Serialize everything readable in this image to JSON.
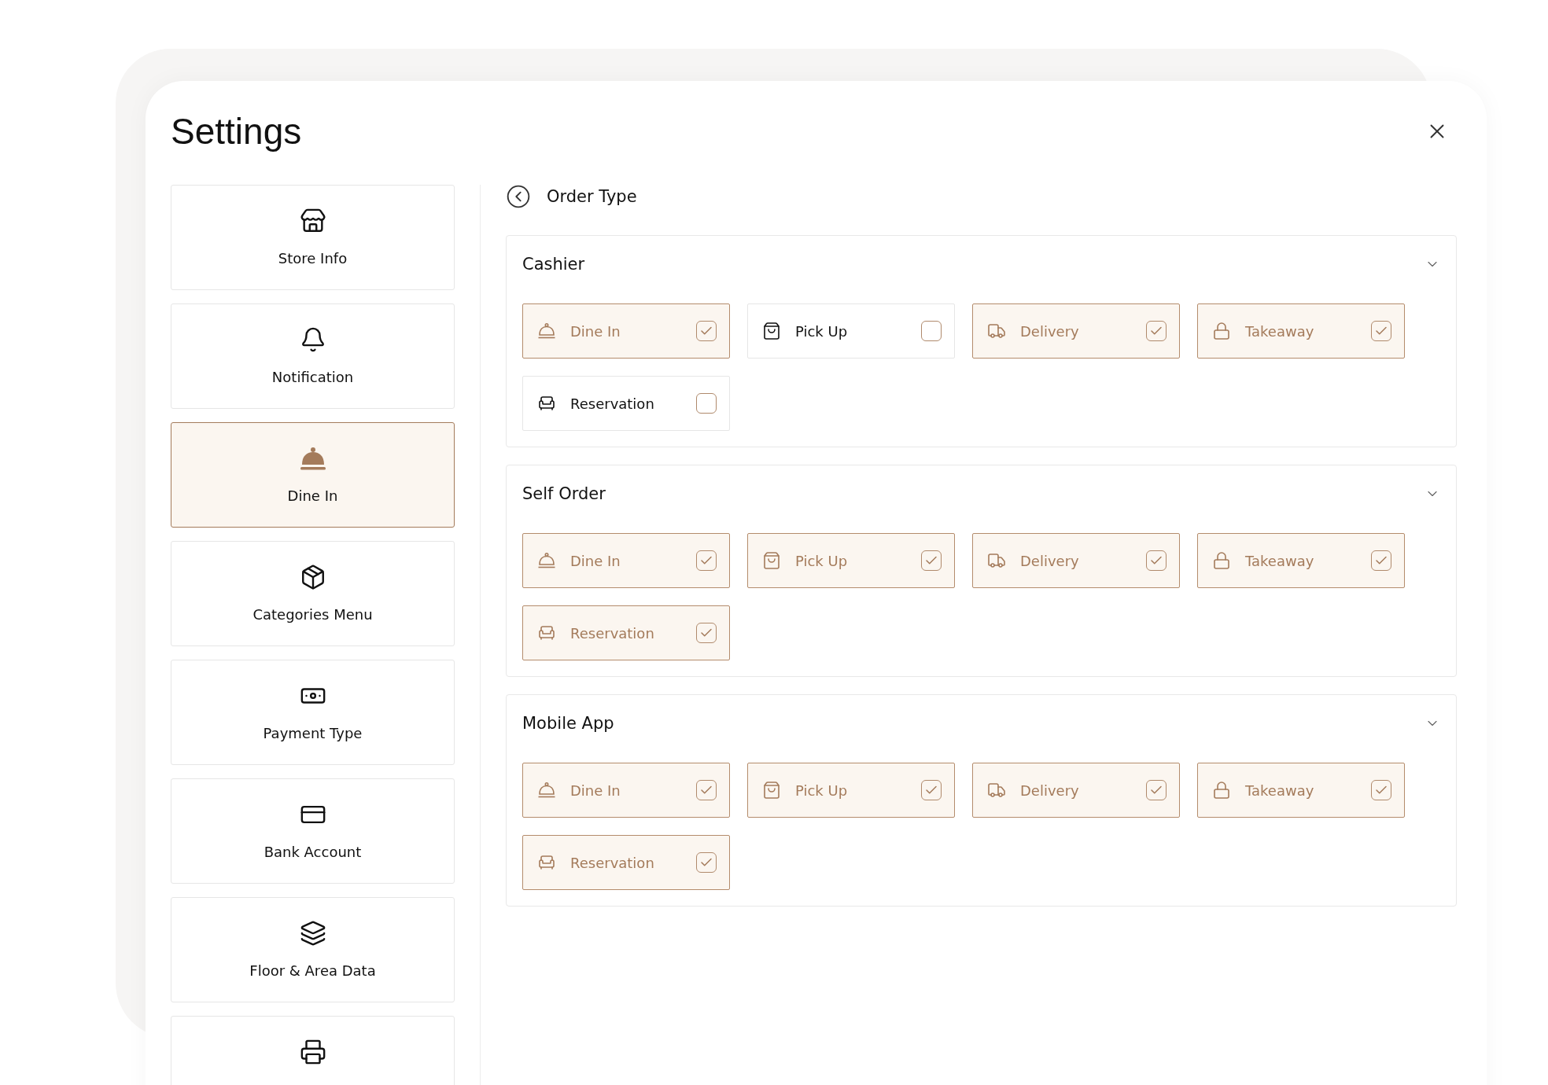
{
  "title": "Settings",
  "sidebar": {
    "items": [
      {
        "label": "Store Info",
        "selected": false
      },
      {
        "label": "Notification",
        "selected": false
      },
      {
        "label": "Dine In",
        "selected": true
      },
      {
        "label": "Categories Menu",
        "selected": false
      },
      {
        "label": "Payment Type",
        "selected": false
      },
      {
        "label": "Bank Account",
        "selected": false
      },
      {
        "label": "Floor & Area Data",
        "selected": false
      },
      {
        "selected": false
      }
    ]
  },
  "content": {
    "title": "Order Type",
    "sections": [
      {
        "title": "Cashier",
        "expanded": true,
        "options": [
          {
            "label": "Dine In",
            "checked": true
          },
          {
            "label": "Pick Up",
            "checked": false
          },
          {
            "label": "Delivery",
            "checked": true
          },
          {
            "label": "Takeaway",
            "checked": true
          },
          {
            "label": "Reservation",
            "checked": false
          }
        ]
      },
      {
        "title": "Self Order",
        "expanded": true,
        "options": [
          {
            "label": "Dine In",
            "checked": true
          },
          {
            "label": "Pick Up",
            "checked": true
          },
          {
            "label": "Delivery",
            "checked": true
          },
          {
            "label": "Takeaway",
            "checked": true
          },
          {
            "label": "Reservation",
            "checked": true
          }
        ]
      },
      {
        "title": "Mobile App",
        "expanded": true,
        "options": [
          {
            "label": "Dine In",
            "checked": true
          },
          {
            "label": "Pick Up",
            "checked": true
          },
          {
            "label": "Delivery",
            "checked": true
          },
          {
            "label": "Takeaway",
            "checked": true
          },
          {
            "label": "Reservation",
            "checked": true
          }
        ]
      }
    ]
  }
}
